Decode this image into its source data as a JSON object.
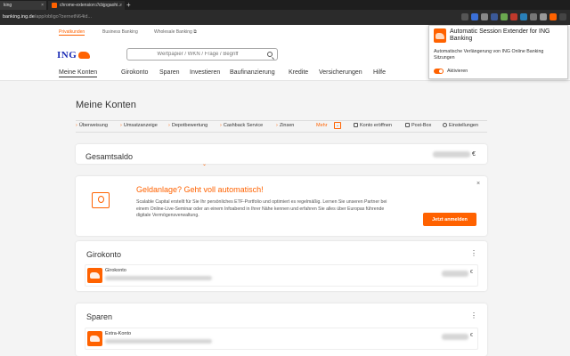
{
  "browser": {
    "tabs": [
      {
        "label": "king"
      },
      {
        "label": "chrome-extension://cbjpgaohi..."
      }
    ],
    "new_tab": "+",
    "close_glyph": "×",
    "url_host": "banking.ing.de",
    "url_path": "/app/obligo?zernetN64id..."
  },
  "topnav": {
    "items": [
      "Privatkunden",
      "Business Banking",
      "Wholesale Banking ⧉"
    ]
  },
  "logo": {
    "text": "ING"
  },
  "search": {
    "placeholder": "Wertpapier / WKN / Frage / Begriff"
  },
  "mainnav": {
    "items": [
      "Meine Konten",
      "Girokonto",
      "Sparen",
      "Investieren",
      "Baufinanzierung",
      "Kredite",
      "Versicherungen",
      "Hilfe"
    ]
  },
  "page": {
    "title": "Meine Konten"
  },
  "quicklinks": {
    "items": [
      "Überweisung",
      "Umsatzanzeige",
      "Depotbewertung",
      "Cashback Service",
      "Zinsen"
    ],
    "more_label": "Mehr",
    "more_glyph": "⌄",
    "actions": [
      "Konto eröffnen",
      "Post-Box",
      "Einstellungen"
    ]
  },
  "total": {
    "label": "Gesamtsaldo",
    "currency": "€",
    "expand_glyph": "⌄"
  },
  "promo": {
    "title": "Geldanlage? Geht voll automatisch!",
    "text": "Scalable Capital erstellt für Sie Ihr persönliches ETF-Portfolio und optimiert es regelmäßig. Lernen Sie unseren Partner bei einem Online-Live-Seminar oder an einem Infoabend in Ihrer Nähe kennen und erfahren Sie alles über Europas führende digitale Vermögensverwaltung.",
    "button": "Jetzt anmelden",
    "close_glyph": "×"
  },
  "sections": [
    {
      "title": "Girokonto",
      "account": "Girokonto",
      "currency": "€"
    },
    {
      "title": "Sparen",
      "account": "Extra-Konto",
      "currency": "€"
    }
  ],
  "kebab_glyph": "⋮",
  "popup": {
    "title": "Automatic Session Extender for ING Banking",
    "description": "Automatische Verlängerung von ING Online Banking Sitzungen",
    "toggle_label": "Aktivieren",
    "toggle_on": true
  },
  "colors": {
    "accent": "#ff6200",
    "brand_blue": "#1a2bb5"
  },
  "icons": [
    "bulb-icon",
    "search-icon",
    "ing-lion-icon",
    "kebab-icon",
    "close-icon",
    "chevron-down-icon"
  ]
}
